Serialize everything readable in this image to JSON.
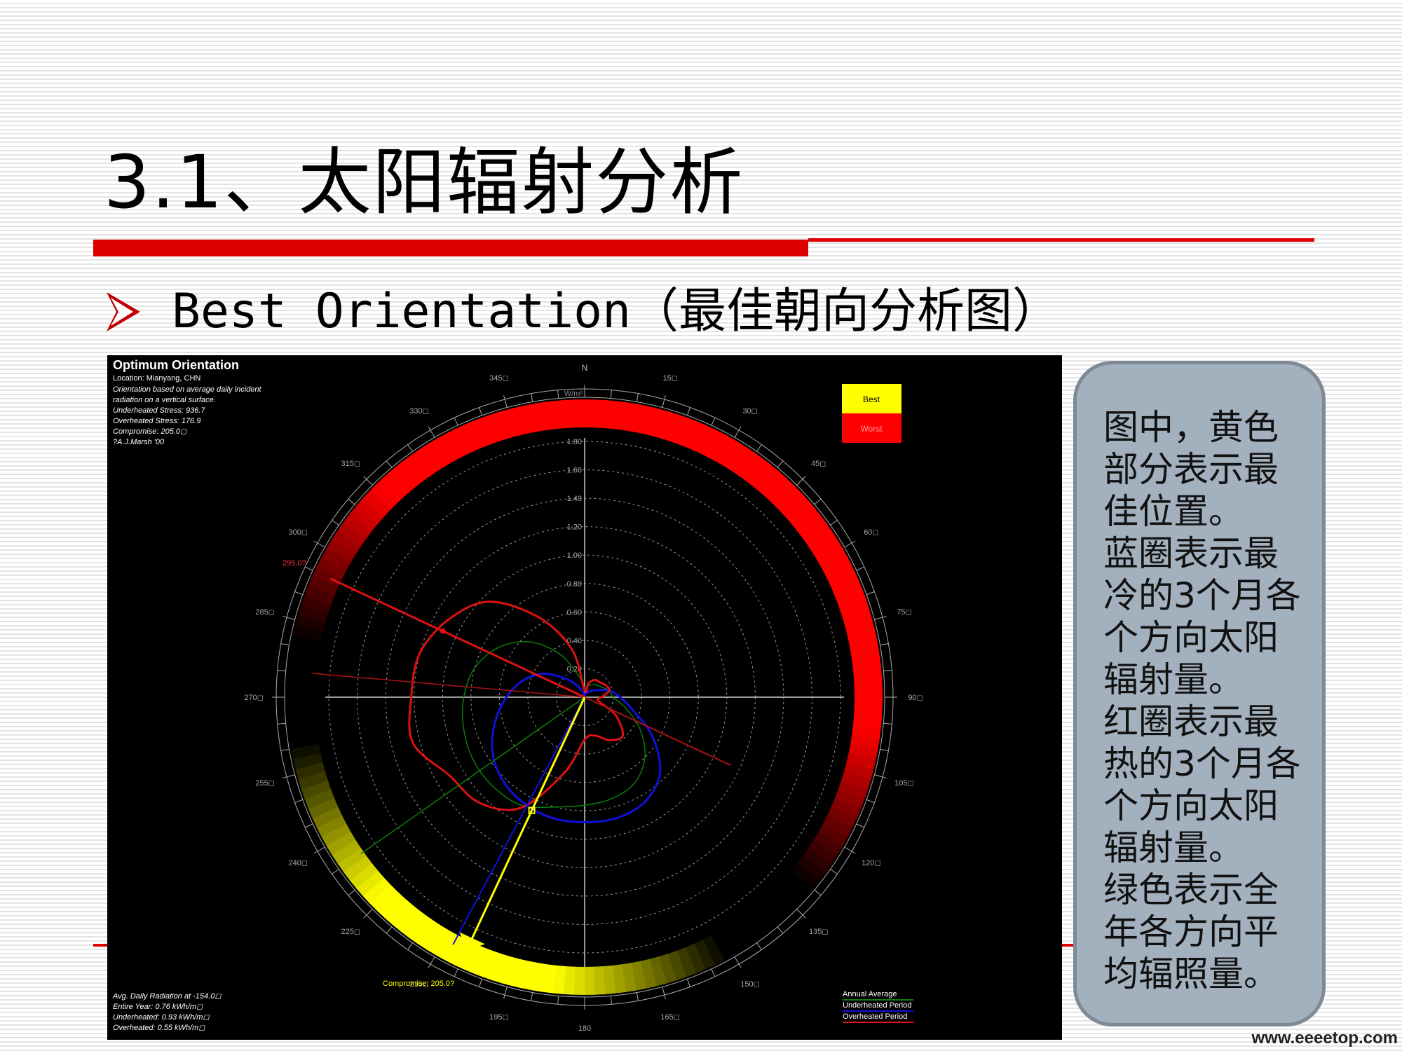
{
  "slide": {
    "title": "3.1、太阳辐射分析",
    "subtitle": "Best Orientation（最佳朝向分析图）",
    "panel_text": "图中，黄色\n部分表示最\n佳位置。\n蓝圈表示最\n冷的3个月各\n个方向太阳\n辐射量。\n红圈表示最\n热的3个月各\n个方向太阳\n辐射量。\n绿色表示全\n年各方向平\n均辐照量。",
    "watermark": "www.eeeetop.com"
  },
  "figure": {
    "heading": "Optimum Orientation",
    "info_lines": [
      "Location: Mianyang, CHN",
      " Orientation based on average daily incident",
      " radiation on a vertical surface.",
      " Underheated Stress: 936.7",
      " Overheated Stress: 176.9",
      " Compromise: 205.0◻",
      " ?A.J.Marsh '00"
    ],
    "best_label": "Best",
    "worst_label": "Worst",
    "unit_label": "W/m²",
    "north_label": "N",
    "compass_labels": [
      "15◻",
      "30◻",
      "45◻",
      "60◻",
      "75◻",
      "90◻",
      "105◻",
      "120◻",
      "135◻",
      "150◻",
      "165◻",
      "180",
      "195◻",
      "210◻",
      "225◻",
      "240◻",
      "255◻",
      "270◻",
      "285◻",
      "300◻",
      "315◻",
      "330◻",
      "345◻"
    ],
    "radial_labels": [
      "0.20",
      "0.40",
      "0.60",
      "0.80",
      "1.00",
      "1.20",
      "1.40",
      "1.60",
      "1.80"
    ],
    "best_marker": "295.0?",
    "compromise_label": "Compromise: 205.0?",
    "bottom_lines": [
      "Avg. Daily Radiation at -154.0◻",
      " Entire Year: 0.76 kWh/m◻",
      " Underheated: 0.93 kWh/m◻",
      " Overheated: 0.55 kWh/m◻"
    ],
    "legend": [
      "Annual Average",
      "Underheated Period",
      "Overheated Period"
    ],
    "colors": {
      "best": "#ffff00",
      "worst": "#ff0000",
      "annual": "#0b7f0b",
      "underheated": "#1010dd",
      "overheated": "#dd1111"
    }
  },
  "chart_data": {
    "type": "polar",
    "title": "Optimum Orientation",
    "r_unit": "W/m²",
    "r_ticks": [
      0.2,
      0.4,
      0.6,
      0.8,
      1.0,
      1.2,
      1.4,
      1.6,
      1.8
    ],
    "rlim": [
      0,
      1.8
    ],
    "angle_ticks_deg": [
      0,
      15,
      30,
      45,
      60,
      75,
      90,
      105,
      120,
      135,
      150,
      165,
      180,
      195,
      210,
      225,
      240,
      255,
      270,
      285,
      300,
      315,
      330,
      345
    ],
    "compromise_deg": 205.0,
    "best_marker_deg": 295.0,
    "series": [
      {
        "name": "Overheated Period",
        "color": "#dd1111",
        "angles": [
          0,
          15,
          30,
          45,
          60,
          75,
          90,
          105,
          120,
          135,
          150,
          165,
          180,
          195,
          210,
          225,
          240,
          255,
          270,
          285,
          300,
          315,
          330,
          345
        ],
        "values": [
          0.05,
          0.1,
          0.14,
          0.15,
          0.17,
          0.18,
          0.12,
          0.1,
          0.25,
          0.38,
          0.35,
          0.28,
          0.3,
          0.55,
          0.9,
          1.05,
          1.1,
          1.25,
          1.22,
          1.2,
          1.1,
          0.95,
          0.65,
          0.35
        ]
      },
      {
        "name": "Underheated Period",
        "color": "#1010dd",
        "angles": [
          0,
          15,
          30,
          45,
          60,
          75,
          90,
          105,
          120,
          135,
          150,
          165,
          180,
          195,
          210,
          225,
          240,
          255,
          270,
          285,
          300,
          315,
          330,
          345
        ],
        "values": [
          0.01,
          0.02,
          0.04,
          0.06,
          0.1,
          0.18,
          0.25,
          0.35,
          0.55,
          0.75,
          0.85,
          0.88,
          0.88,
          0.88,
          0.86,
          0.82,
          0.75,
          0.65,
          0.55,
          0.45,
          0.33,
          0.18,
          0.08,
          0.03
        ]
      },
      {
        "name": "Annual Average",
        "color": "#0b7f0b",
        "angles": [
          0,
          15,
          30,
          45,
          60,
          75,
          90,
          105,
          120,
          135,
          150,
          165,
          180,
          195,
          210,
          225,
          240,
          255,
          270,
          285,
          300,
          315,
          330,
          345
        ],
        "values": [
          0.06,
          0.08,
          0.1,
          0.12,
          0.14,
          0.18,
          0.2,
          0.3,
          0.45,
          0.6,
          0.7,
          0.74,
          0.76,
          0.8,
          0.88,
          0.9,
          0.9,
          0.88,
          0.85,
          0.8,
          0.7,
          0.55,
          0.35,
          0.15
        ]
      }
    ]
  }
}
